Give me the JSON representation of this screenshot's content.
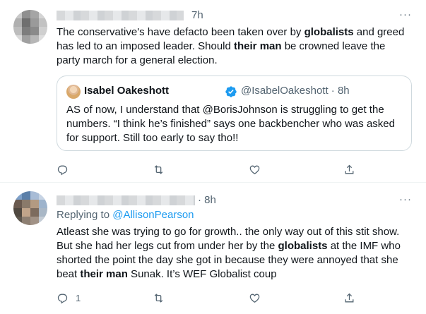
{
  "tweet1": {
    "time": "7h",
    "more_label": "···",
    "text_parts": [
      {
        "t": "The conservative's have defacto been taken over by ",
        "b": false
      },
      {
        "t": "globalists",
        "b": true
      },
      {
        "t": " and greed has led to an imposed leader. Should ",
        "b": false
      },
      {
        "t": "their man",
        "b": true
      },
      {
        "t": " be crowned leave the party march for a general election.",
        "b": false
      }
    ],
    "quote": {
      "name": "Isabel Oakeshott",
      "handle_time": "@IsabelOakeshott · 8h",
      "text": "AS of now, I understand that @BorisJohnson is struggling to get the numbers. “I think he’s finished” says one backbencher who was asked for support. Still too early to say tho!!",
      "verified_color": "#1d9bf0"
    },
    "actions": {
      "reply_count": "",
      "retweet_count": "",
      "like_count": ""
    }
  },
  "tweet2": {
    "time": "· 8h",
    "more_label": "···",
    "replying_prefix": "Replying to ",
    "replying_handle": "@AllisonPearson",
    "text_parts": [
      {
        "t": "Atleast she was trying to go for growth..  the only way out of this stit show. But she had her legs cut from under her by the ",
        "b": false
      },
      {
        "t": "globalists",
        "b": true
      },
      {
        "t": " at the IMF who shorted the point the day she got in because they were annoyed that she beat ",
        "b": false
      },
      {
        "t": "their man",
        "b": true
      },
      {
        "t": " Sunak. It’s WEF Globalist coup",
        "b": false
      }
    ],
    "actions": {
      "reply_count": "1",
      "retweet_count": "",
      "like_count": ""
    }
  },
  "colors": {
    "text": "#0f1419",
    "muted": "#536471",
    "link": "#1d9bf0",
    "border": "#cfd9de"
  }
}
